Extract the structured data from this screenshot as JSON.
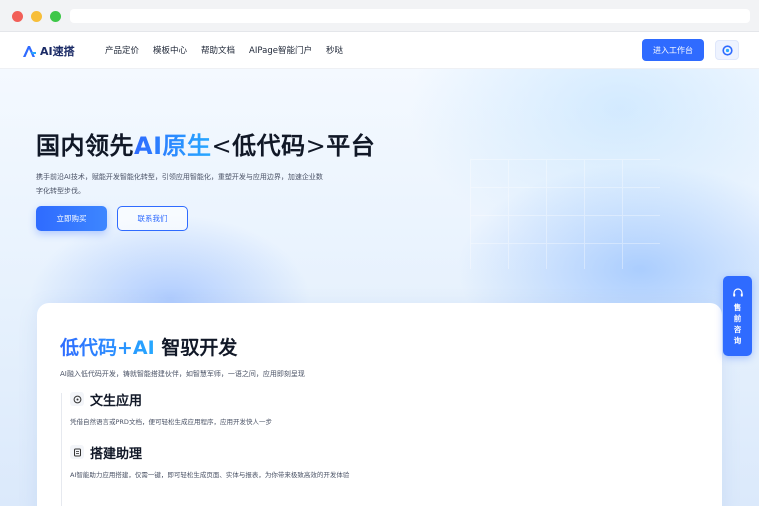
{
  "header": {
    "logo_text": "AI速搭",
    "nav": [
      "产品定价",
      "模板中心",
      "帮助文档",
      "AIPage智能门户",
      "秒哒"
    ],
    "enter_label": "进入工作台"
  },
  "hero": {
    "title_pre": "国内领先",
    "title_accent": "AI原生",
    "title_open": "<",
    "title_mid": "低代码",
    "title_close": ">",
    "title_post": "平台",
    "desc": "携手前沿AI技术，赋能开发智能化转型，引领应用智能化，重塑开发与应用边界，加速企业数字化转型步伐。",
    "buy_label": "立即购买",
    "contact_label": "联系我们"
  },
  "card": {
    "title_accent": "低代码+AI",
    "title_post": " 智驭开发",
    "subtitle": "AI融入低代码开发，铸就智能搭建伙伴，如智慧军师，一语之间，应用即刻呈现",
    "features": [
      {
        "title": "文生应用",
        "desc": "凭借自然语言或PRD文档，便可轻松生成应用程序，应用开发快人一步"
      },
      {
        "title": "搭建助理",
        "desc": "AI智能助力应用搭建，仅需一键，即可轻松生成页面、实体与报表，为你带来极致高效的开发体验"
      }
    ]
  },
  "float": {
    "presale_label": "售前咨询"
  },
  "colors": {
    "accent": "#2f6bff",
    "accent_light": "#27a9ff"
  }
}
